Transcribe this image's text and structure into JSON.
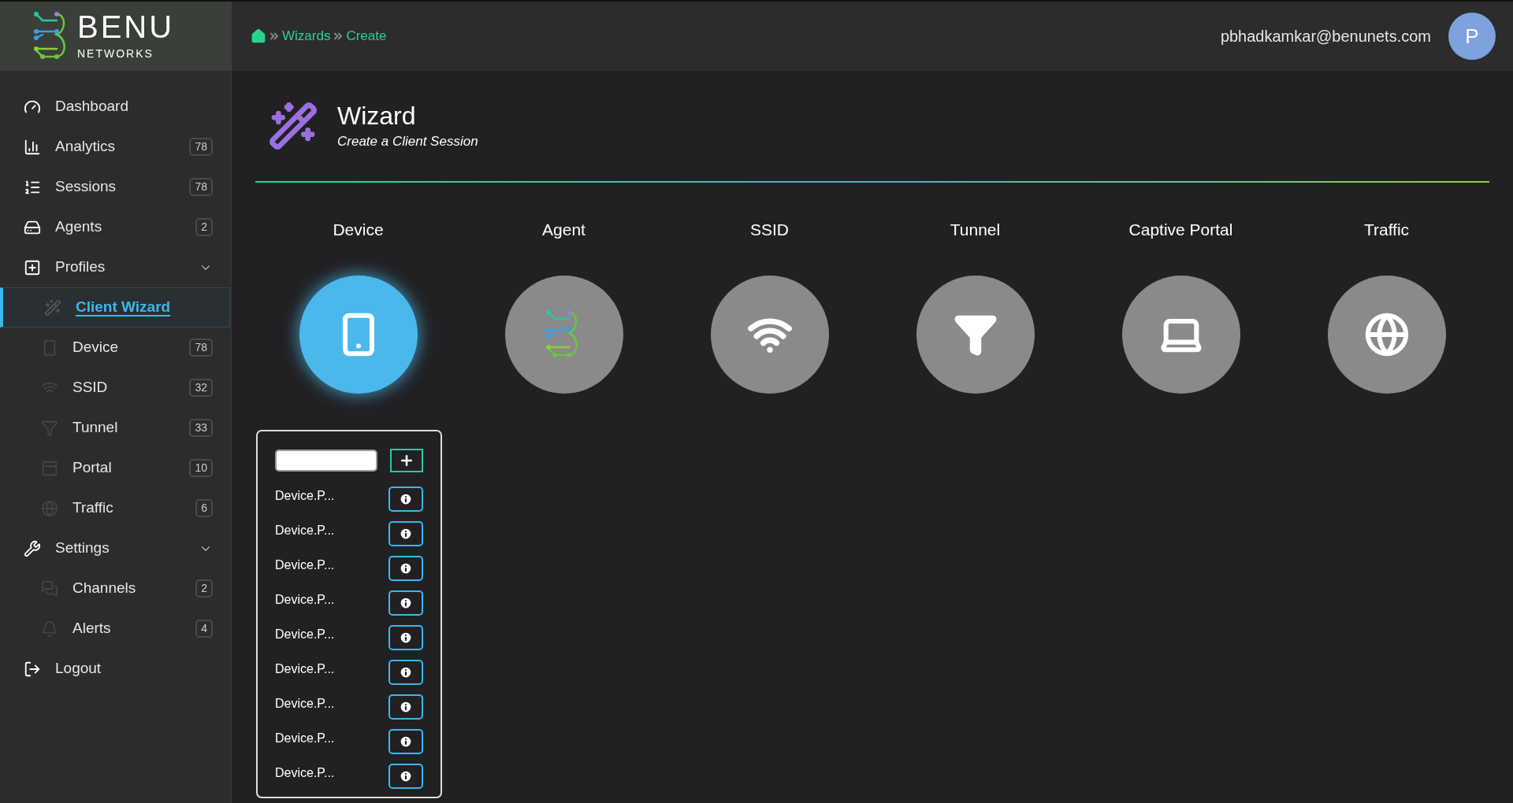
{
  "header": {
    "logo": {
      "name": "BENU",
      "tagline": "NETWORKS"
    },
    "breadcrumb": [
      "Wizards",
      "Create"
    ],
    "user": {
      "email": "pbhadkamkar@benunets.com",
      "avatar": "P"
    }
  },
  "sidebar": {
    "items": [
      {
        "kind": "main",
        "label": "Dashboard",
        "selected": false
      },
      {
        "kind": "main",
        "label": "Analytics",
        "badge": "78",
        "selected": false
      },
      {
        "kind": "main",
        "label": "Sessions",
        "badge": "78",
        "selected": false
      },
      {
        "kind": "main",
        "label": "Agents",
        "badge": "2",
        "selected": false
      },
      {
        "kind": "group",
        "label": "Profiles",
        "expanded": true,
        "selected": false
      },
      {
        "kind": "sub",
        "label": "Client Wizard",
        "selected": true
      },
      {
        "kind": "sub",
        "label": "Device",
        "badge": "78",
        "selected": false
      },
      {
        "kind": "sub",
        "label": "SSID",
        "badge": "32",
        "selected": false
      },
      {
        "kind": "sub",
        "label": "Tunnel",
        "badge": "33",
        "selected": false
      },
      {
        "kind": "sub",
        "label": "Portal",
        "badge": "10",
        "selected": false
      },
      {
        "kind": "sub",
        "label": "Traffic",
        "badge": "6",
        "selected": false
      },
      {
        "kind": "group",
        "label": "Settings",
        "expanded": true,
        "selected": false
      },
      {
        "kind": "sub",
        "label": "Channels",
        "badge": "2",
        "selected": false
      },
      {
        "kind": "sub",
        "label": "Alerts",
        "badge": "4",
        "selected": false
      },
      {
        "kind": "main",
        "label": "Logout",
        "selected": false
      }
    ]
  },
  "page": {
    "title": "Wizard",
    "subtitle": "Create a Client Session"
  },
  "steps": [
    {
      "label": "Device",
      "selected": true
    },
    {
      "label": "Agent",
      "selected": false
    },
    {
      "label": "SSID",
      "selected": false
    },
    {
      "label": "Tunnel",
      "selected": false
    },
    {
      "label": "Captive Portal",
      "selected": false
    },
    {
      "label": "Traffic",
      "selected": false
    }
  ],
  "device_panel": {
    "items": [
      "Device.P...",
      "Device.P...",
      "Device.P...",
      "Device.P...",
      "Device.P...",
      "Device.P...",
      "Device.P...",
      "Device.P...",
      "Device.P..."
    ]
  }
}
